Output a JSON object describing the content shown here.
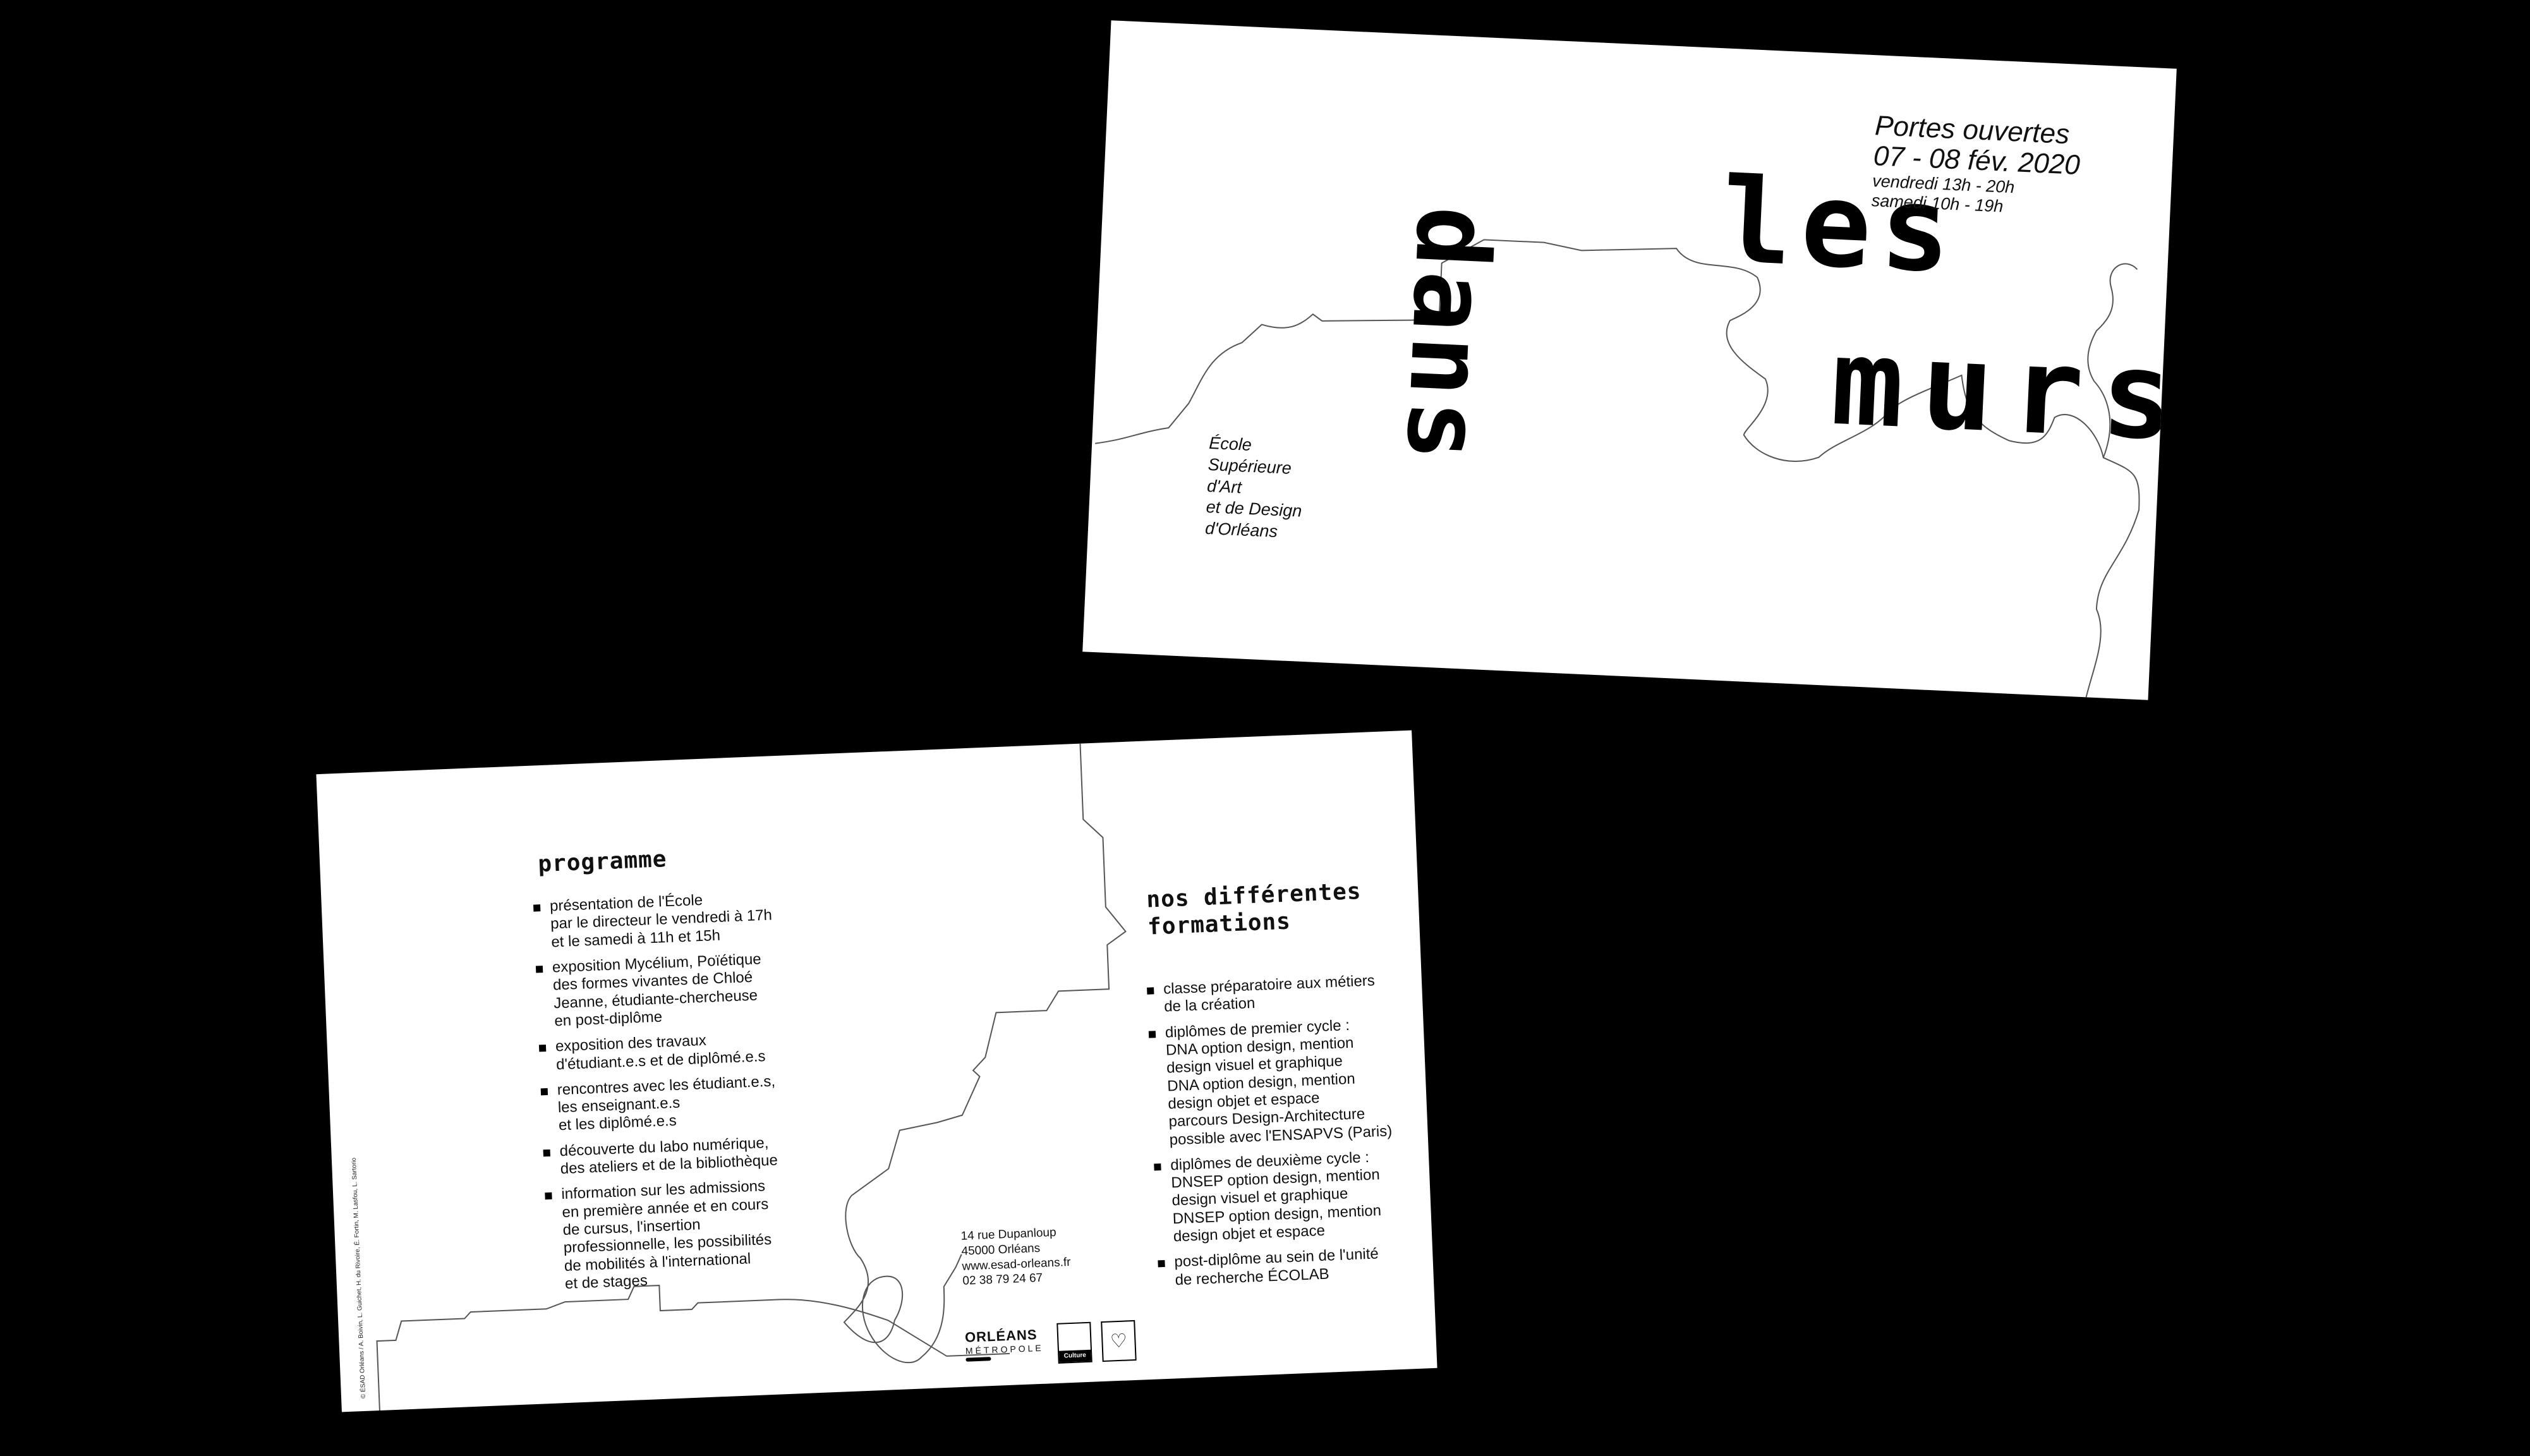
{
  "front": {
    "open_days": {
      "title": "Portes ouvertes",
      "dates": "07 - 08 fév. 2020",
      "friday": "vendredi 13h - 20h",
      "saturday": "samedi 10h - 19h"
    },
    "headline_words": [
      "dans",
      "les",
      "murs"
    ],
    "school": [
      "École",
      "Supérieure",
      "d'Art",
      "et de Design",
      "d'Orléans"
    ]
  },
  "back": {
    "program_title": "programme",
    "program_items": [
      [
        "présentation de l'École",
        "par le directeur le vendredi à 17h",
        "et le samedi à 11h et 15h"
      ],
      [
        "exposition Mycélium, Poïétique",
        "des formes vivantes de Chloé",
        "Jeanne, étudiante-chercheuse",
        "en post-diplôme"
      ],
      [
        "exposition des travaux",
        "d'étudiant.e.s et de diplômé.e.s"
      ],
      [
        "rencontres avec les étudiant.e.s,",
        "les enseignant.e.s",
        "et les diplômé.e.s"
      ],
      [
        "découverte du labo numérique,",
        "des ateliers et de la bibliothèque"
      ],
      [
        "information sur les admissions",
        "en première année et en cours",
        "de cursus, l'insertion",
        "professionnelle, les possibilités",
        "de mobilités à l'international",
        "et de stages"
      ]
    ],
    "formations_title": [
      "nos différentes",
      "formations"
    ],
    "formations_items": [
      [
        "classe préparatoire aux métiers",
        "de la création"
      ],
      [
        "diplômes de premier cycle :",
        "DNA option design, mention",
        "design visuel et graphique",
        "DNA option design, mention",
        "design objet et espace",
        "parcours Design-Architecture",
        "possible avec l'ENSAPVS (Paris)"
      ],
      [
        "diplômes de deuxième cycle :",
        "DNSEP option design, mention",
        "design visuel et graphique",
        "DNSEP option design, mention",
        "design objet et espace"
      ],
      [
        "post-diplôme au sein de l'unité",
        "de recherche ÉCOLAB"
      ]
    ],
    "address": [
      "14 rue Dupanloup",
      "45000 Orléans",
      "www.esad-orleans.fr",
      "02 38 79 24 67"
    ],
    "credits": "© ÉSAD Orléans / A. Boivin, L. Guichet, H. du Rivoire, É. Fortin, M. Lasfou, L. Sartorio",
    "logos": {
      "orleans_line1": "ORLÉANS",
      "orleans_line2": "MÉTROPOLE",
      "ministry_band": "Culture"
    }
  }
}
